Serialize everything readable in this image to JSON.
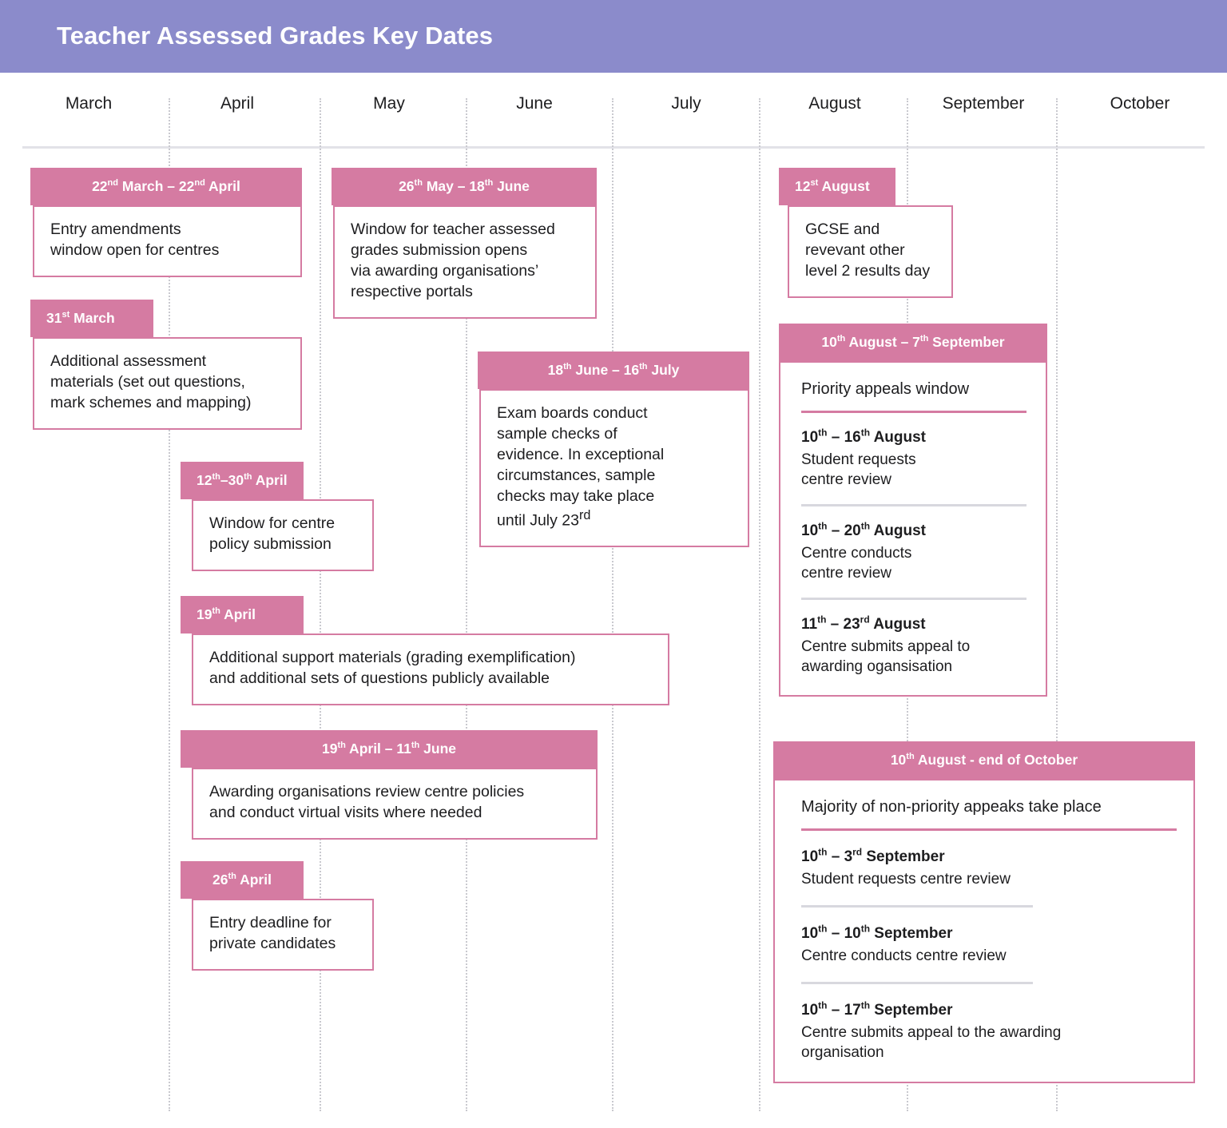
{
  "header": {
    "title": "Teacher Assessed Grades Key Dates",
    "background_color": "#8b8bcb",
    "text_color": "#ffffff"
  },
  "theme": {
    "accent_pink": "#d57ba2",
    "axis_line": "#e2e2e8",
    "guide_dots": "#c9c9cf",
    "text": "#1d1d1f"
  },
  "timeline": {
    "months": [
      {
        "label": "March"
      },
      {
        "label": "April"
      },
      {
        "label": "May"
      },
      {
        "label": "June"
      },
      {
        "label": "July"
      },
      {
        "label": "August"
      },
      {
        "label": "September"
      },
      {
        "label": "October"
      }
    ]
  },
  "cards": {
    "entry_amendments": {
      "date": "22nd March – 22nd April",
      "date_num1": "22",
      "date_sup1": "nd",
      "date_mid": " March – ",
      "date_num2": "22",
      "date_sup2": "nd",
      "date_end": " April",
      "body_line1": "Entry amendments",
      "body_line2": "window open for centres"
    },
    "additional_assessment": {
      "date_num1": "31",
      "date_sup1": "st",
      "date_end": " March",
      "body_line1": "Additional assessment",
      "body_line2": "materials (set out questions,",
      "body_line3": "mark schemes and mapping)"
    },
    "centre_policy": {
      "date_num1": "12",
      "date_sup1": "th",
      "date_mid": "–",
      "date_num2": "30",
      "date_sup2": "th",
      "date_end": " April",
      "body_line1": "Window for centre",
      "body_line2": "policy submission"
    },
    "support_materials": {
      "date_num1": "19",
      "date_sup1": "th",
      "date_end": " April",
      "body_line1": "Additional support materials (grading exemplification)",
      "body_line2": "and additional sets of questions publicly available"
    },
    "ao_review": {
      "date_num1": "19",
      "date_sup1": "th",
      "date_mid": " April – ",
      "date_num2": "11",
      "date_sup2": "th",
      "date_end": " June",
      "body_line1": "Awarding organisations review centre policies",
      "body_line2": "and conduct virtual visits where needed"
    },
    "private_candidates": {
      "date_num1": "26",
      "date_sup1": "th",
      "date_end": " April",
      "body_line1": "Entry deadline for",
      "body_line2": "private candidates"
    },
    "tag_submission": {
      "date_num1": "26",
      "date_sup1": "th",
      "date_mid": " May –  ",
      "date_num2": "18",
      "date_sup2": "th",
      "date_end": " June",
      "body_line1": "Window for teacher assessed",
      "body_line2": "grades submission opens",
      "body_line3": "via awarding organisations’",
      "body_line4": "respective portals"
    },
    "sample_checks": {
      "date_num1": "18",
      "date_sup1": "th",
      "date_mid": " June – ",
      "date_num2": "16",
      "date_sup2": "th",
      "date_end": " July",
      "body_line1": "Exam boards conduct",
      "body_line2": "sample checks of",
      "body_line3": "evidence. In exceptional",
      "body_line4": "circumstances, sample",
      "body_line5": "checks may take place",
      "body_line6_pre": "until July 23",
      "body_line6_sup": "rd"
    },
    "results_day": {
      "date_num1": "12",
      "date_sup1": "st",
      "date_end": " August",
      "body_line1": "GCSE and",
      "body_line2": "revevant other",
      "body_line3": "level 2 results day"
    },
    "priority_appeals": {
      "date_num1": "10",
      "date_sup1": "th",
      "date_mid": " August – ",
      "date_num2": "7",
      "date_sup2": "th",
      "date_end": " September",
      "lead": "Priority appeals window",
      "entries": [
        {
          "d_num1": "10",
          "d_sup1": "th",
          "d_mid": " – ",
          "d_num2": "16",
          "d_sup2": "th",
          "d_end": " August",
          "text_line1": "Student requests",
          "text_line2": "centre review"
        },
        {
          "d_num1": "10",
          "d_sup1": "th",
          "d_mid": " – ",
          "d_num2": "20",
          "d_sup2": "th",
          "d_end": " August",
          "text_line1": "Centre conducts",
          "text_line2": "centre review"
        },
        {
          "d_num1": "11",
          "d_sup1": "th",
          "d_mid": " – ",
          "d_num2": "23",
          "d_sup2": "rd",
          "d_end": " August",
          "text_line1": "Centre submits appeal to",
          "text_line2": "awarding ogansisation"
        }
      ]
    },
    "non_priority_appeals": {
      "date_num1": "10",
      "date_sup1": "th",
      "date_end": " August - end of October",
      "lead": "Majority of non-priority appeaks take place",
      "entries": [
        {
          "d_num1": "10",
          "d_sup1": "th",
          "d_mid": " – ",
          "d_num2": "3",
          "d_sup2": "rd",
          "d_end": " September",
          "text_line1": "Student requests centre review"
        },
        {
          "d_num1": "10",
          "d_sup1": "th",
          "d_mid": " – ",
          "d_num2": "10",
          "d_sup2": "th",
          "d_end": " September",
          "text_line1": "Centre conducts centre review"
        },
        {
          "d_num1": "10",
          "d_sup1": "th",
          "d_mid": " – ",
          "d_num2": "17",
          "d_sup2": "th",
          "d_end": " September",
          "text_line1": "Centre submits appeal to the awarding",
          "text_line2": "organisation"
        }
      ]
    }
  }
}
